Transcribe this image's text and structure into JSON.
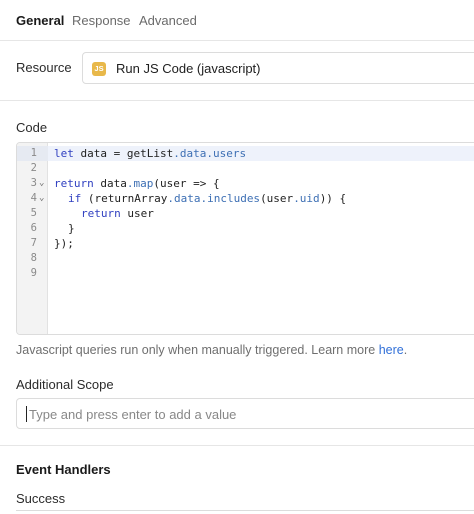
{
  "tabs": [
    {
      "label": "General",
      "active": true
    },
    {
      "label": "Response",
      "active": false
    },
    {
      "label": "Advanced",
      "active": false
    }
  ],
  "resource": {
    "label": "Resource",
    "badge": "JS",
    "value": "Run JS Code (javascript)",
    "badge_color": "#e8b84a"
  },
  "code": {
    "label": "Code",
    "lines": [
      {
        "number": "1",
        "fold": false
      },
      {
        "number": "2",
        "fold": false
      },
      {
        "number": "3",
        "fold": true
      },
      {
        "number": "4",
        "fold": true
      },
      {
        "number": "5",
        "fold": false
      },
      {
        "number": "6",
        "fold": false
      },
      {
        "number": "7",
        "fold": false
      },
      {
        "number": "8",
        "fold": false
      },
      {
        "number": "9",
        "fold": false
      }
    ],
    "line1": {
      "kw": "let",
      "a": " data = getList",
      "b": ".data.users"
    },
    "line3": {
      "kw": "return",
      "a": " data",
      "b": ".map",
      "c": "(user => {"
    },
    "line4": {
      "kw": "if",
      "a": " (returnArray",
      "b": ".data.includes",
      "c": "(user",
      "d": ".uid",
      "e": ")) {"
    },
    "line5": {
      "kw": "return",
      "a": " user"
    },
    "line6": "}",
    "line7": "});",
    "hint_text": "Javascript queries run only when manually triggered. Learn more ",
    "hint_link": "here",
    "hint_end": "."
  },
  "scope": {
    "label": "Additional Scope",
    "placeholder": "Type and press enter to add a value"
  },
  "events": {
    "label": "Event Handlers",
    "success_label": "Success"
  },
  "colors": {
    "keyword": "#2f3fc0",
    "property": "#3d6fb4",
    "link": "#3170d8"
  }
}
